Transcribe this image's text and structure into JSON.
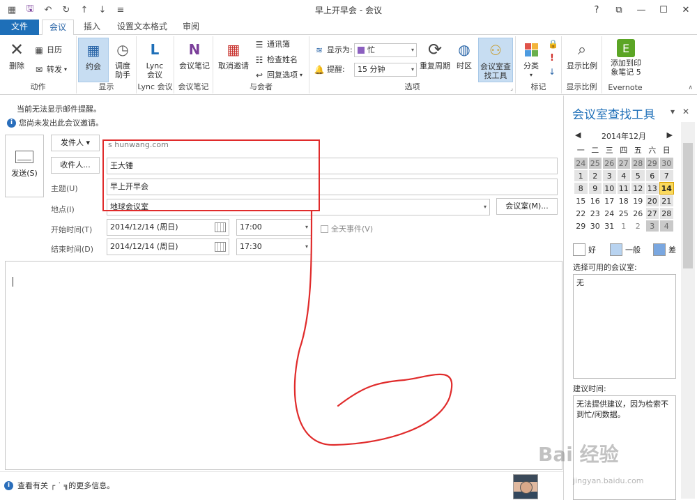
{
  "window": {
    "title": "早上开早会 - 会议",
    "controls": [
      "?",
      "⧉",
      "—",
      "☐",
      "✕"
    ]
  },
  "tabs": [
    {
      "label": "文件"
    },
    {
      "label": "会议"
    },
    {
      "label": "插入"
    },
    {
      "label": "设置文本格式"
    },
    {
      "label": "审阅"
    }
  ],
  "ribbon": {
    "actions": {
      "delete": "删除",
      "calendar": "日历",
      "forward": "转发",
      "group": "动作"
    },
    "show": {
      "appointment": "约会",
      "scheduling": "调度助手",
      "group": "显示"
    },
    "lync": {
      "meeting": "Lync 会议",
      "group": "Lync 会议"
    },
    "notes": {
      "meeting_notes": "会议笔记",
      "group": "会议笔记"
    },
    "attendees": {
      "cancel": "取消邀请",
      "address_book": "通讯簿",
      "check_names": "检查姓名",
      "response_options": "回复选项",
      "group": "与会者"
    },
    "options": {
      "show_as_label": "显示为:",
      "show_as_value": "忙",
      "reminder_label": "提醒:",
      "reminder_value": "15 分钟",
      "recurrence": "重复周期",
      "time_zones": "时区",
      "room_finder": "会议室查找工具",
      "group": "选项"
    },
    "tags": {
      "categorize": "分类",
      "group": "标记"
    },
    "zoom": {
      "zoom": "显示比例",
      "group": "显示比例"
    },
    "evernote": {
      "add": "添加到印象笔记 5",
      "group": "Evernote"
    }
  },
  "info": {
    "line1": "当前无法显示邮件提醒。",
    "line2": "您尚未发出此会议邀请。"
  },
  "form": {
    "send": "发送(S)",
    "from_button": "发件人 ▾",
    "from_value": "s               hunwang.com",
    "to_button": "收件人...",
    "to_value": "王大锤",
    "subject_label": "主题(U)",
    "subject_value": "早上开早会",
    "location_label": "地点(I)",
    "location_value": "地球会议室",
    "rooms_button": "会议室(M)...",
    "start_label": "开始时间(T)",
    "start_date": "2014/12/14 (周日)",
    "start_time": "17:00",
    "end_label": "结束时间(D)",
    "end_date": "2014/12/14 (周日)",
    "end_time": "17:30",
    "all_day": "全天事件(V)"
  },
  "status": {
    "text": "查看有关 ┌ ˙  ╗的更多信息。"
  },
  "pane": {
    "title": "会议室查找工具",
    "month": "2014年12月",
    "weekdays": [
      "一",
      "二",
      "三",
      "四",
      "五",
      "六",
      "日"
    ],
    "weeks": [
      [
        [
          "24",
          "g"
        ],
        [
          "25",
          "g"
        ],
        [
          "26",
          "g"
        ],
        [
          "27",
          "g"
        ],
        [
          "28",
          "g"
        ],
        [
          "29",
          "g"
        ],
        [
          "30",
          "g"
        ]
      ],
      [
        [
          "1",
          "d"
        ],
        [
          "2",
          "d"
        ],
        [
          "3",
          "d"
        ],
        [
          "4",
          "d"
        ],
        [
          "5",
          "d"
        ],
        [
          "6",
          "d"
        ],
        [
          "7",
          "d"
        ]
      ],
      [
        [
          "8",
          "d"
        ],
        [
          "9",
          "d"
        ],
        [
          "10",
          "d"
        ],
        [
          "11",
          "d"
        ],
        [
          "12",
          "d"
        ],
        [
          "13",
          "d"
        ],
        [
          "14",
          "t"
        ]
      ],
      [
        [
          "15",
          "w"
        ],
        [
          "16",
          "w"
        ],
        [
          "17",
          "w"
        ],
        [
          "18",
          "w"
        ],
        [
          "19",
          "w"
        ],
        [
          "20",
          "d"
        ],
        [
          "21",
          "d"
        ]
      ],
      [
        [
          "22",
          "w"
        ],
        [
          "23",
          "w"
        ],
        [
          "24",
          "w"
        ],
        [
          "25",
          "w"
        ],
        [
          "26",
          "w"
        ],
        [
          "27",
          "d"
        ],
        [
          "28",
          "d"
        ]
      ],
      [
        [
          "29",
          "w"
        ],
        [
          "30",
          "w"
        ],
        [
          "31",
          "w"
        ],
        [
          "1",
          "lt"
        ],
        [
          "2",
          "lt"
        ],
        [
          "3",
          "g"
        ],
        [
          "4",
          "g"
        ]
      ]
    ],
    "legend": [
      {
        "label": "好",
        "color": "#ffffff"
      },
      {
        "label": "一般",
        "color": "#b8d3f0"
      },
      {
        "label": "差",
        "color": "#7aa7e0"
      }
    ],
    "available_label": "选择可用的会议室:",
    "available_value": "无",
    "suggest_label": "建议时间:",
    "suggest_value": "无法提供建议，因为检索不到忙/闲数据。"
  },
  "watermark": {
    "brand": "Bai 经验",
    "url": "jingyan.baidu.com"
  },
  "colors": {
    "accent": "#1e6fb8",
    "annotation": "#e02b2b",
    "today": "#fad95c"
  }
}
